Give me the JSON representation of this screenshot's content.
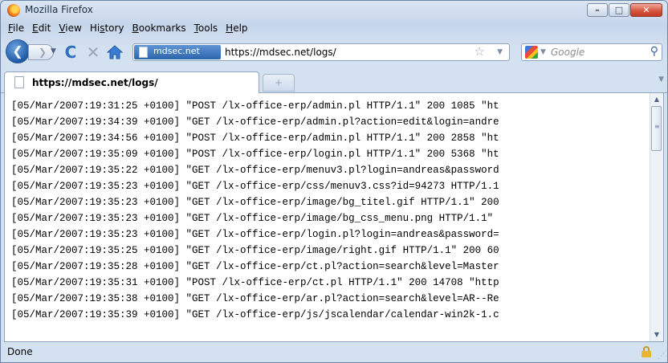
{
  "window": {
    "title": "Mozilla Firefox",
    "minimize_glyph": "–",
    "maximize_glyph": "□",
    "close_glyph": "✕"
  },
  "menu": [
    "File",
    "Edit",
    "View",
    "History",
    "Bookmarks",
    "Tools",
    "Help"
  ],
  "menu_accel": [
    "F",
    "E",
    "V",
    "s",
    "B",
    "T",
    "H"
  ],
  "nav": {
    "back_glyph": "❮",
    "forward_glyph": "❯",
    "reload_glyph": "C",
    "stop_glyph": "✕",
    "site_name": "mdsec.net",
    "url": "https://mdsec.net/logs/",
    "star_glyph": "☆",
    "search_placeholder": "Google",
    "search_glyph": "⚲"
  },
  "tabs": {
    "active_label": "https://mdsec.net/logs/",
    "new_tab_glyph": "+"
  },
  "log_lines": [
    "[05/Mar/2007:19:31:25 +0100] \"POST /lx-office-erp/admin.pl HTTP/1.1\" 200 1085 \"ht",
    "[05/Mar/2007:19:34:39 +0100] \"GET /lx-office-erp/admin.pl?action=edit&login=andre",
    "[05/Mar/2007:19:34:56 +0100] \"POST /lx-office-erp/admin.pl HTTP/1.1\" 200 2858 \"ht",
    "[05/Mar/2007:19:35:09 +0100] \"POST /lx-office-erp/login.pl HTTP/1.1\" 200 5368 \"ht",
    "[05/Mar/2007:19:35:22 +0100] \"GET /lx-office-erp/menuv3.pl?login=andreas&password",
    "[05/Mar/2007:19:35:23 +0100] \"GET /lx-office-erp/css/menuv3.css?id=94273 HTTP/1.1",
    "[05/Mar/2007:19:35:23 +0100] \"GET /lx-office-erp/image/bg_titel.gif HTTP/1.1\" 200",
    "[05/Mar/2007:19:35:23 +0100] \"GET /lx-office-erp/image/bg_css_menu.png HTTP/1.1\"",
    "[05/Mar/2007:19:35:23 +0100] \"GET /lx-office-erp/login.pl?login=andreas&password=",
    "[05/Mar/2007:19:35:25 +0100] \"GET /lx-office-erp/image/right.gif HTTP/1.1\" 200 60",
    "[05/Mar/2007:19:35:28 +0100] \"GET /lx-office-erp/ct.pl?action=search&level=Master",
    "[05/Mar/2007:19:35:31 +0100] \"POST /lx-office-erp/ct.pl HTTP/1.1\" 200 14708 \"http",
    "[05/Mar/2007:19:35:38 +0100] \"GET /lx-office-erp/ar.pl?action=search&level=AR--Re",
    "[05/Mar/2007:19:35:39 +0100] \"GET /lx-office-erp/js/jscalendar/calendar-win2k-1.c"
  ],
  "status": {
    "text": "Done"
  }
}
